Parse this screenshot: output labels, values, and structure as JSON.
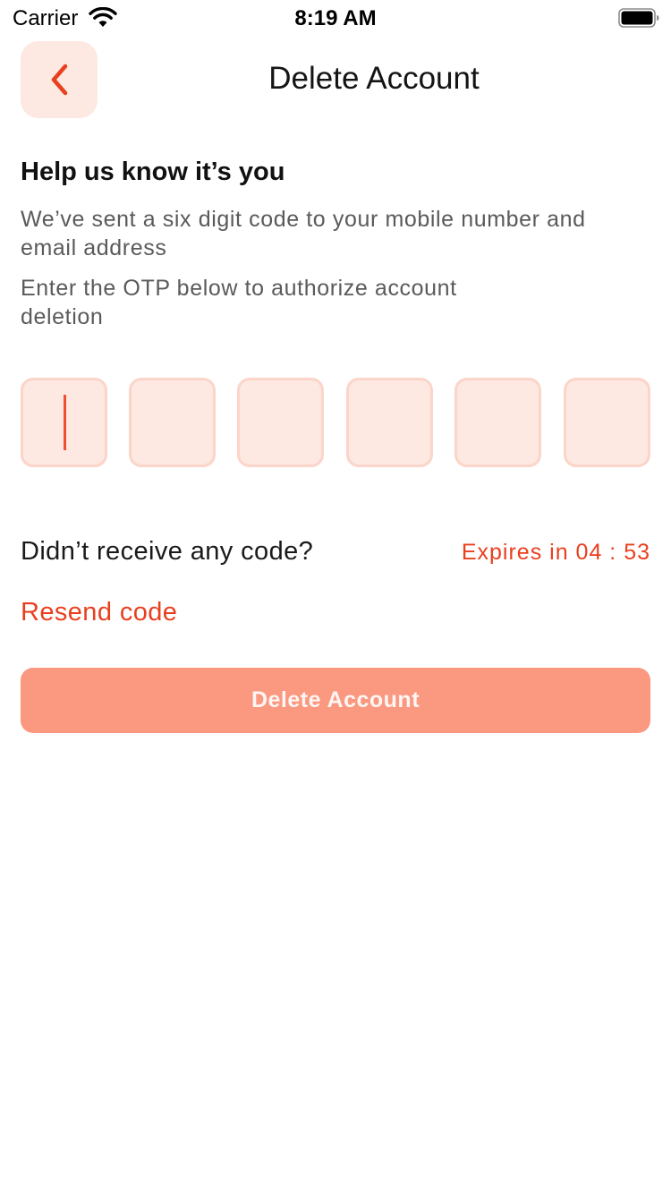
{
  "status_bar": {
    "carrier": "Carrier",
    "time": "8:19 AM",
    "icons": [
      "wifi-icon",
      "battery-icon"
    ]
  },
  "header": {
    "back_icon": "chevron-left-icon",
    "title": "Delete Account"
  },
  "intro": {
    "heading": "Help us know it’s you",
    "text_1": "We’ve sent a six digit code to your mobile number and email address",
    "text_2": "Enter the OTP below to authorize account deletion"
  },
  "otp": {
    "digits": [
      "",
      "",
      "",
      "",
      "",
      ""
    ],
    "focused_index": 0
  },
  "resend": {
    "prompt": "Didn’t receive any code?",
    "expiry_prefix": "Expires in",
    "expiry_time": "04 : 53",
    "link_label": "Resend code"
  },
  "delete_button": {
    "label": "Delete Account"
  },
  "colors": {
    "accent": "#e8401f",
    "box_fill": "#fde8e2",
    "box_border": "#fbd5c9",
    "button_disabled": "#fa9880"
  }
}
